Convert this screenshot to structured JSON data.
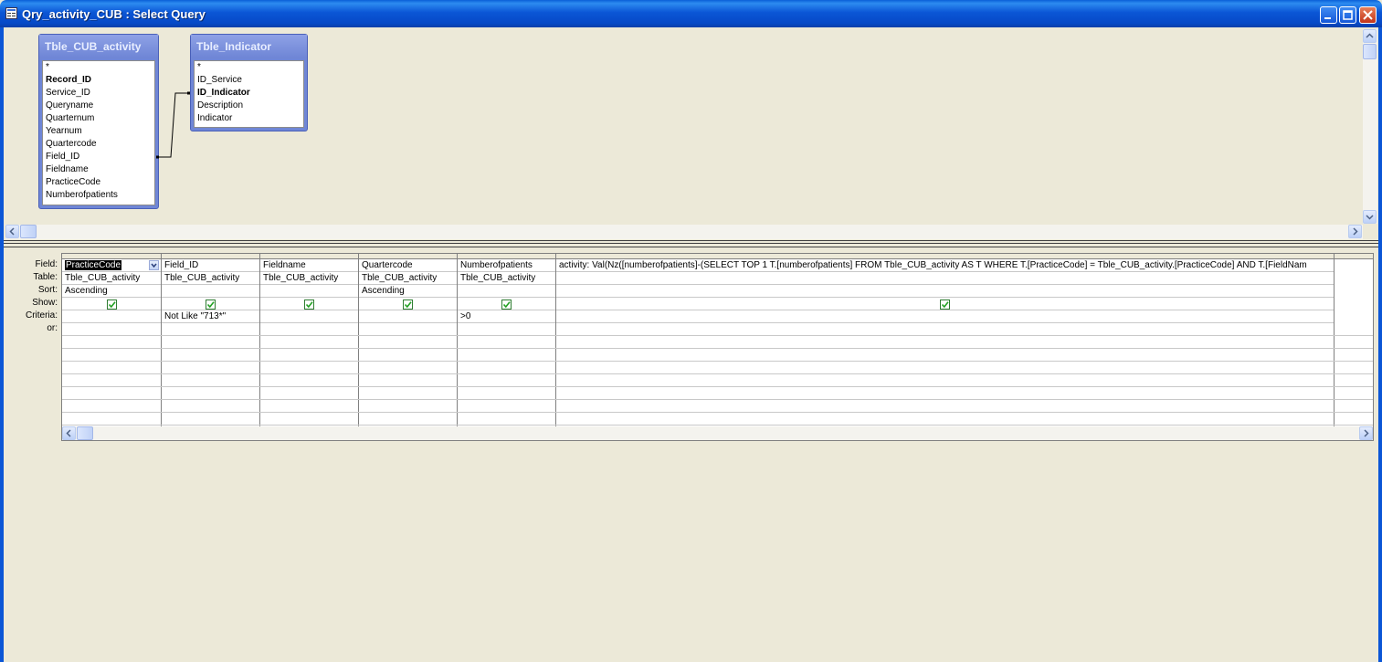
{
  "window": {
    "title": "Qry_activity_CUB : Select Query"
  },
  "tables": [
    {
      "name": "Tble_CUB_activity",
      "fields": [
        {
          "label": "*",
          "pk": false
        },
        {
          "label": "Record_ID",
          "pk": true
        },
        {
          "label": "Service_ID",
          "pk": false
        },
        {
          "label": "Queryname",
          "pk": false
        },
        {
          "label": "Quarternum",
          "pk": false
        },
        {
          "label": "Yearnum",
          "pk": false
        },
        {
          "label": "Quartercode",
          "pk": false
        },
        {
          "label": "Field_ID",
          "pk": false
        },
        {
          "label": "Fieldname",
          "pk": false
        },
        {
          "label": "PracticeCode",
          "pk": false
        },
        {
          "label": "Numberofpatients",
          "pk": false
        }
      ]
    },
    {
      "name": "Tble_Indicator",
      "fields": [
        {
          "label": "*",
          "pk": false
        },
        {
          "label": "ID_Service",
          "pk": false
        },
        {
          "label": "ID_Indicator",
          "pk": true
        },
        {
          "label": "Description",
          "pk": false
        },
        {
          "label": "Indicator",
          "pk": false
        }
      ]
    }
  ],
  "grid": {
    "row_labels": [
      "Field:",
      "Table:",
      "Sort:",
      "Show:",
      "Criteria:",
      "or:"
    ],
    "columns": [
      {
        "field": "PracticeCode",
        "table": "Tble_CUB_activity",
        "sort": "Ascending",
        "show": true,
        "criteria": ""
      },
      {
        "field": "Field_ID",
        "table": "Tble_CUB_activity",
        "sort": "",
        "show": true,
        "criteria": "Not Like \"713*\""
      },
      {
        "field": "Fieldname",
        "table": "Tble_CUB_activity",
        "sort": "",
        "show": true,
        "criteria": ""
      },
      {
        "field": "Quartercode",
        "table": "Tble_CUB_activity",
        "sort": "Ascending",
        "show": true,
        "criteria": ""
      },
      {
        "field": "Numberofpatients",
        "table": "Tble_CUB_activity",
        "sort": "",
        "show": true,
        "criteria": ">0"
      },
      {
        "field": "activity: Val(Nz([numberofpatients]-(SELECT TOP 1 T.[numberofpatients] FROM Tble_CUB_activity AS T  WHERE T.[PracticeCode] = Tble_CUB_activity.[PracticeCode]  AND T.[FieldNam",
        "table": "",
        "sort": "",
        "show": true,
        "criteria": ""
      }
    ]
  },
  "colors": {
    "titlebar": "#0b56d6",
    "tablebox": "#6f86d6",
    "background": "#ece9d8"
  }
}
